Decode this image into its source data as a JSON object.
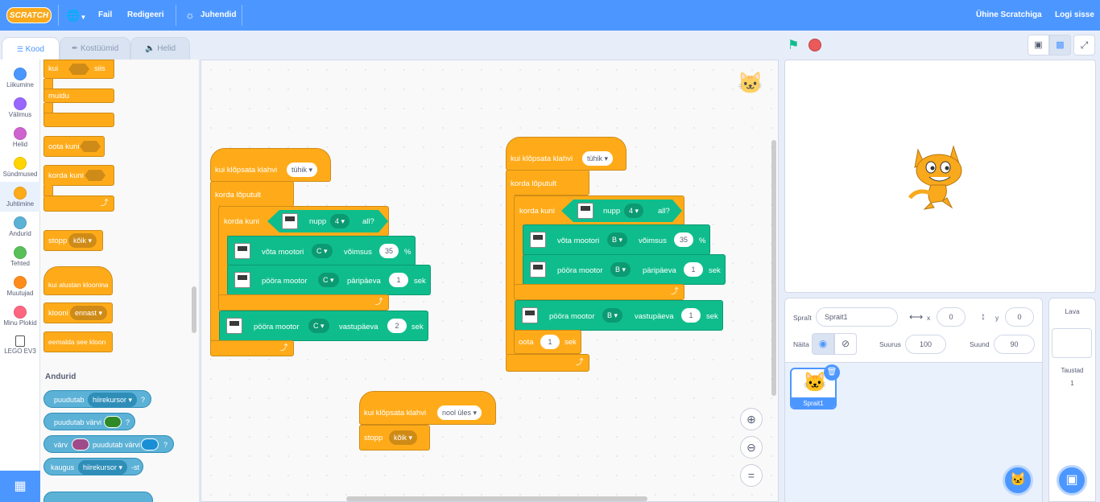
{
  "menubar": {
    "logo": "SCRATCH",
    "file": "Fail",
    "edit": "Redigeeri",
    "tutorials": "Juhendid",
    "join": "Ühine Scratchiga",
    "signin": "Logi sisse"
  },
  "tabs": {
    "code": "Kood",
    "costumes": "Kostüümid",
    "sounds": "Helid"
  },
  "categories": [
    {
      "label": "Liikumine",
      "color": "#4c97ff"
    },
    {
      "label": "Välimus",
      "color": "#9966ff"
    },
    {
      "label": "Helid",
      "color": "#cf63cf"
    },
    {
      "label": "Sündmused",
      "color": "#ffd500"
    },
    {
      "label": "Juhtimine",
      "color": "#ffab19"
    },
    {
      "label": "Andurid",
      "color": "#5cb1d6"
    },
    {
      "label": "Tehted",
      "color": "#59c059"
    },
    {
      "label": "Muutujad",
      "color": "#ff8c1a"
    },
    {
      "label": "Minu Plokid",
      "color": "#ff6680"
    },
    {
      "label": "LEGO EV3",
      "color": "#ffffff"
    }
  ],
  "palette": {
    "if_then": [
      "kui",
      "siis"
    ],
    "else": "muidu",
    "wait_until": "oota kuni",
    "repeat_until": "korda kuni",
    "stop": "stopp",
    "stop_opt": "kõik",
    "clone_start": "kui alustan kloonina",
    "clone": "klooni",
    "clone_opt": "ennast",
    "delete_clone": "eemalda see kloon",
    "sensing_header": "Andurid",
    "touching": "puudutab",
    "touching_opt": "hiirekursor",
    "q": "?",
    "touching_color": "puudutab värvi",
    "color_touching": [
      "värv",
      "puudutab värvi"
    ],
    "distance": [
      "kaugus",
      "hiirekursor",
      "-st"
    ]
  },
  "script1": {
    "hat": "kui klõpsata klahvi",
    "hat_key": "tühik",
    "forever": "korda lõputult",
    "repeat_until": "korda kuni",
    "button": "nupp",
    "button_num": "4",
    "all": "all?",
    "motor_power": "võta mootori",
    "motor": "C",
    "power": "võimsus",
    "power_val": "35",
    "pct": "%",
    "turn_cw": "pööra mootor",
    "cw": "päripäeva",
    "cw_val": "1",
    "sec": "sek",
    "turn_ccw": "pööra mootor",
    "ccw": "vastupäeva",
    "ccw_val": "2"
  },
  "script2": {
    "hat": "kui klõpsata klahvi",
    "hat_key": "tühik",
    "forever": "korda lõputult",
    "repeat_until": "korda kuni",
    "button": "nupp",
    "button_num": "4",
    "all": "all?",
    "motor_power": "võta mootori",
    "motor": "B",
    "power": "võimsus",
    "power_val": "35",
    "pct": "%",
    "turn_cw": "pööra mootor",
    "cw": "päripäeva",
    "cw_val": "1",
    "sec": "sek",
    "turn_ccw": "pööra mootor",
    "ccw": "vastupäeva",
    "ccw_val": "1",
    "wait": "oota",
    "wait_val": "1"
  },
  "script3": {
    "hat": "kui klõpsata klahvi",
    "hat_key": "nool üles",
    "stop": "stopp",
    "stop_opt": "kõik"
  },
  "sprite": {
    "label": "Spraît",
    "name": "Sprait1",
    "x_label": "x",
    "x": "0",
    "y_label": "y",
    "y": "0",
    "show": "Näita",
    "size_label": "Suurus",
    "size": "100",
    "dir_label": "Suund",
    "dir": "90",
    "thumb_name": "Sprait1"
  },
  "stage": {
    "label": "Lava",
    "backdrops_label": "Taustad",
    "backdrops_count": "1"
  }
}
